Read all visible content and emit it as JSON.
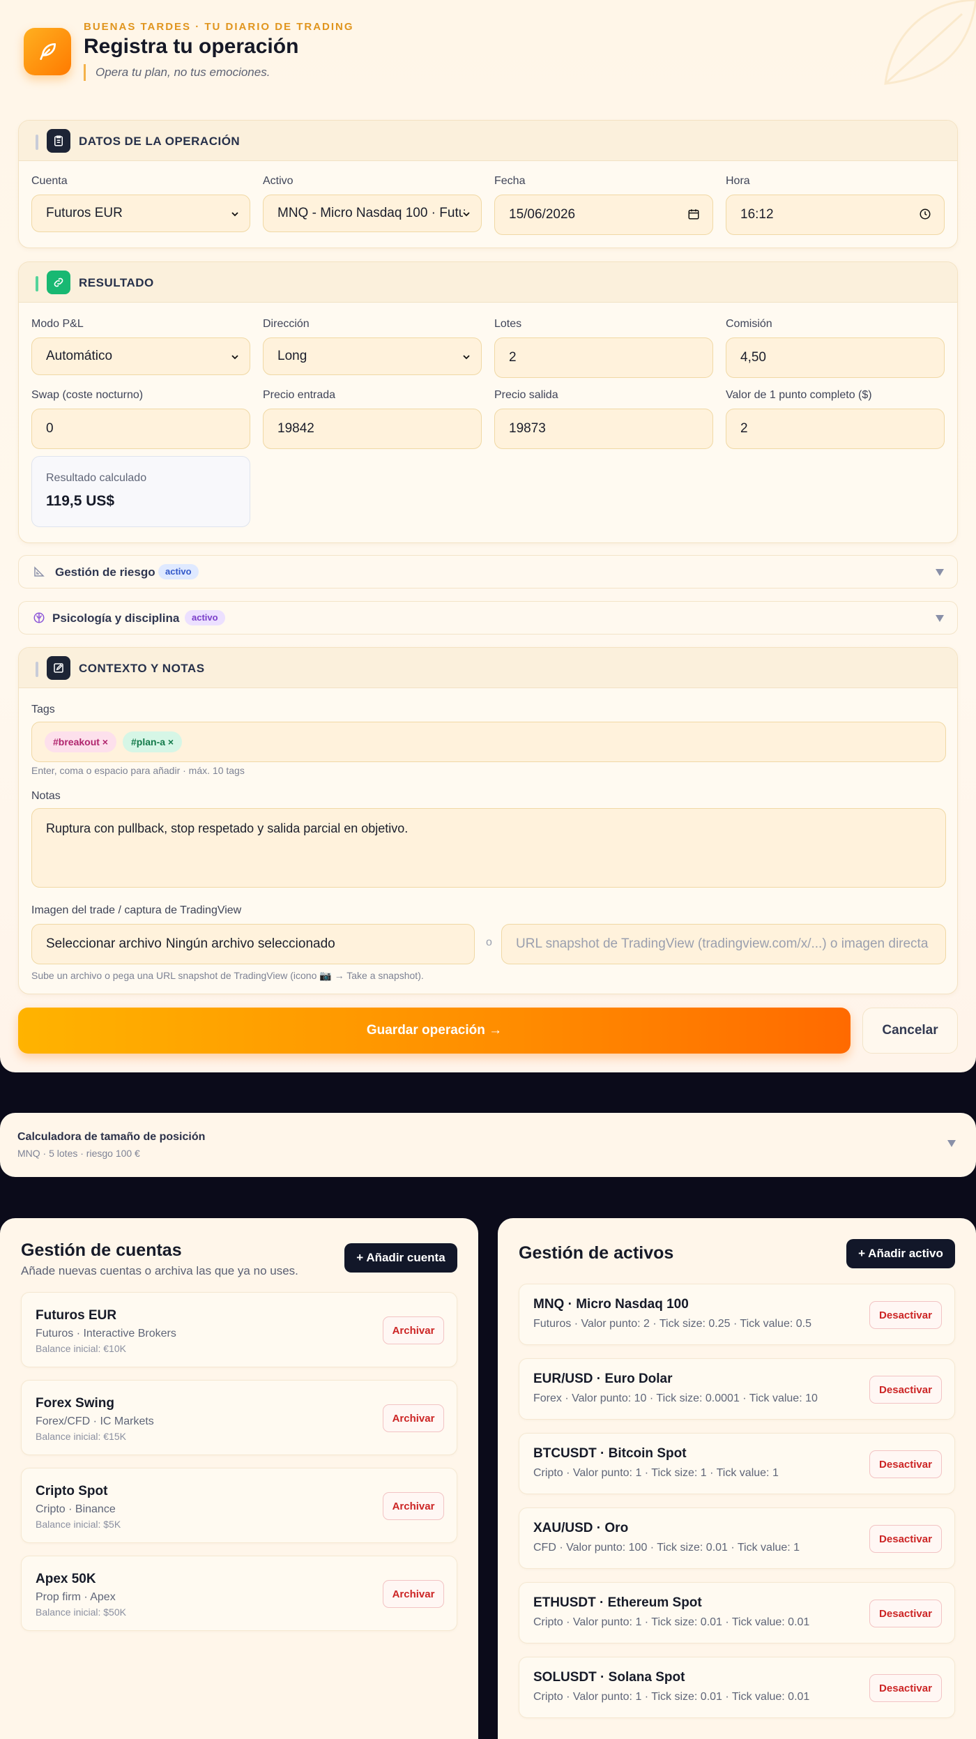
{
  "header": {
    "eyebrow": "BUENAS TARDES · TU DIARIO DE TRADING",
    "title": "Registra tu operación",
    "tagline": "Opera tu plan, no tus emociones."
  },
  "datos": {
    "section_title": "DATOS DE LA OPERACIÓN",
    "cuenta_label": "Cuenta",
    "cuenta_value": "Futuros EUR",
    "activo_label": "Activo",
    "activo_value": "MNQ - Micro Nasdaq 100 · Futu",
    "fecha_label": "Fecha",
    "fecha_value": "15/06/2026",
    "hora_label": "Hora",
    "hora_value": "16:12"
  },
  "resultado": {
    "section_title": "RESULTADO",
    "modo_label": "Modo P&L",
    "modo_value": "Automático",
    "direccion_label": "Dirección",
    "direccion_value": "Long",
    "lotes_label": "Lotes",
    "lotes_value": "2",
    "comision_label": "Comisión",
    "comision_value": "4,50",
    "swap_label": "Swap (coste nocturno)",
    "swap_value": "0",
    "entrada_label": "Precio entrada",
    "entrada_value": "19842",
    "salida_label": "Precio salida",
    "salida_value": "19873",
    "punto_label": "Valor de 1 punto completo ($)",
    "punto_value": "2",
    "calc_label": "Resultado calculado",
    "calc_value": "119,5 US$"
  },
  "riesgo": {
    "label": "Gestión de riesgo",
    "badge": "activo"
  },
  "psicologia": {
    "label": "Psicología y disciplina",
    "badge": "activo"
  },
  "contexto": {
    "section_title": "CONTEXTO Y NOTAS",
    "tags_label": "Tags",
    "tags": [
      "#breakout ×",
      "#plan-a ×"
    ],
    "tags_hint": "Enter, coma o espacio para añadir · máx. 10 tags",
    "notas_label": "Notas",
    "notas_value": "Ruptura con pullback, stop respetado y salida parcial en objetivo.",
    "imagen_label": "Imagen del trade / captura de TradingView",
    "file_button": "Seleccionar archivo",
    "file_status": "Ningún archivo seleccionado",
    "or": "o",
    "url_placeholder": "URL snapshot de TradingView (tradingview.com/x/...) o imagen directa",
    "imagen_hint": "Sube un archivo o pega una URL snapshot de TradingView (icono 📷 → Take a snapshot)."
  },
  "actions": {
    "save": "Guardar operación →",
    "cancel": "Cancelar"
  },
  "calculadora": {
    "title": "Calculadora de tamaño de posición",
    "subtitle": "MNQ · 5 lotes · riesgo 100 €"
  },
  "cuentas": {
    "title": "Gestión de cuentas",
    "subtitle": "Añade nuevas cuentas o archiva las que ya no uses.",
    "add_button": "+ Añadir cuenta",
    "archive_label": "Archivar",
    "items": [
      {
        "name": "Futuros EUR",
        "desc": "Futuros · Interactive Brokers",
        "balance": "Balance inicial: €10K"
      },
      {
        "name": "Forex Swing",
        "desc": "Forex/CFD · IC Markets",
        "balance": "Balance inicial: €15K"
      },
      {
        "name": "Cripto Spot",
        "desc": "Cripto · Binance",
        "balance": "Balance inicial: $5K"
      },
      {
        "name": "Apex 50K",
        "desc": "Prop firm · Apex",
        "balance": "Balance inicial: $50K"
      }
    ]
  },
  "activos": {
    "title": "Gestión de activos",
    "add_button": "+ Añadir activo",
    "deactivate_label": "Desactivar",
    "items": [
      {
        "name": "MNQ · Micro Nasdaq 100",
        "desc": "Futuros · Valor punto: 2 · Tick size: 0.25 · Tick value: 0.5"
      },
      {
        "name": "EUR/USD · Euro Dolar",
        "desc": "Forex · Valor punto: 10 · Tick size: 0.0001 · Tick value: 10"
      },
      {
        "name": "BTCUSDT · Bitcoin Spot",
        "desc": "Cripto · Valor punto: 1 · Tick size: 1 · Tick value: 1"
      },
      {
        "name": "XAU/USD · Oro",
        "desc": "CFD · Valor punto: 100 · Tick size: 0.01 · Tick value: 1"
      },
      {
        "name": "ETHUSDT · Ethereum Spot",
        "desc": "Cripto · Valor punto: 1 · Tick size: 0.01 · Tick value: 0.01"
      },
      {
        "name": "SOLUSDT · Solana Spot",
        "desc": "Cripto · Valor punto: 1 · Tick size: 0.01 · Tick value: 0.01"
      }
    ]
  },
  "colors": {
    "accent": "#ff8c00",
    "dark": "#121729",
    "danger": "#cc2525"
  }
}
